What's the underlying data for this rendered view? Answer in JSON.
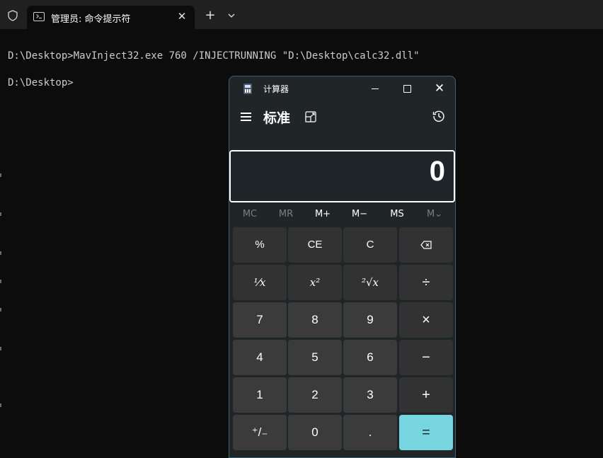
{
  "terminal": {
    "tab_title": "管理员: 命令提示符",
    "close_glyph": "✕",
    "new_tab_glyph": "+",
    "lines": [
      "D:\\Desktop>MavInject32.exe 760 /INJECTRUNNING \"D:\\Desktop\\calc32.dll\"",
      "D:\\Desktop>"
    ]
  },
  "calculator": {
    "window_title": "计算器",
    "mode": "标准",
    "close_glyph": "✕",
    "display": "0",
    "memory": [
      "MC",
      "MR",
      "M+",
      "M−",
      "MS",
      "M⌄"
    ],
    "keys": {
      "percent": "%",
      "ce": "CE",
      "c": "C",
      "reciprocal": "⅟x",
      "square": "x²",
      "sqrt": "²√x",
      "divide": "÷",
      "seven": "7",
      "eight": "8",
      "nine": "9",
      "multiply": "×",
      "four": "4",
      "five": "5",
      "six": "6",
      "minus": "−",
      "one": "1",
      "two": "2",
      "three": "3",
      "plus": "+",
      "negate": "⁺/₋",
      "zero": "0",
      "decimal": ".",
      "equals": "="
    }
  }
}
